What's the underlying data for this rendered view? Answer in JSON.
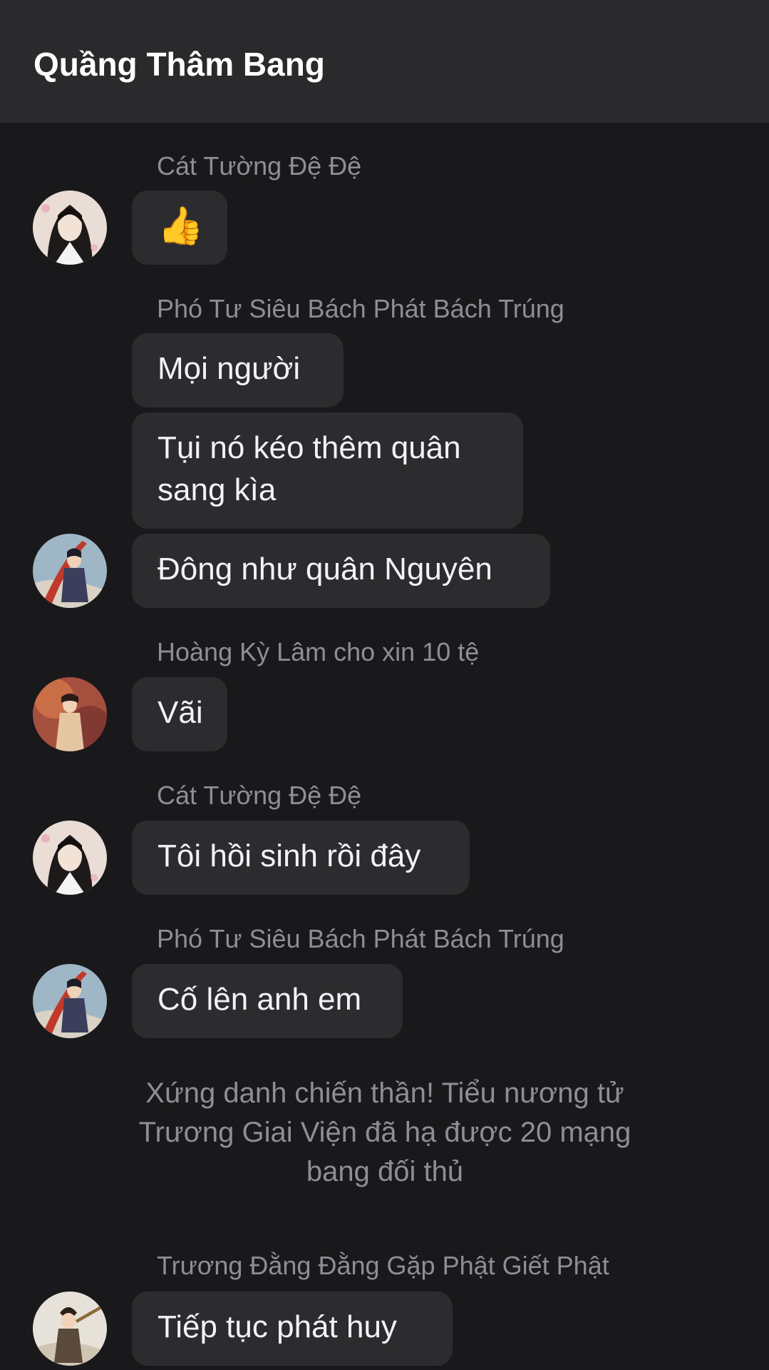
{
  "header": {
    "title": "Quầng Thâm Bang"
  },
  "messages": [
    {
      "sender": "Cát Tường Đệ Đệ",
      "text": "👍"
    },
    {
      "sender": "Phó Tư Siêu Bách Phát Bách Trúng",
      "texts": [
        "Mọi người",
        "Tụi nó kéo thêm quân",
        "sang kìa",
        "Đông như quân Nguyên"
      ]
    },
    {
      "sender": "Hoàng Kỳ Lâm cho xin 10 tệ",
      "text": "Vãi"
    },
    {
      "sender": "Cát Tường Đệ Đệ",
      "text": "Tôi hồi sinh rồi đây"
    },
    {
      "sender": "Phó Tư Siêu Bách Phát Bách Trúng",
      "text": "Cố lên anh em"
    },
    {
      "sender": "Trương Đằng Đằng Gặp Phật Giết Phật",
      "text": "Tiếp tục phát huy"
    }
  ],
  "system_notice": {
    "lines": [
      "Xứng danh chiến thần! Tiểu nương tử",
      "Trương Giai Viện đã hạ được 20 mạng",
      "bang đối thủ"
    ]
  },
  "icons": {
    "thumbs_up": "thumbs-up-emoji",
    "avatars": [
      "avatar-cat-tuong",
      "avatar-pho-tu-sieu",
      "avatar-hoang-ky-lam",
      "avatar-truong-dang-dang"
    ]
  }
}
